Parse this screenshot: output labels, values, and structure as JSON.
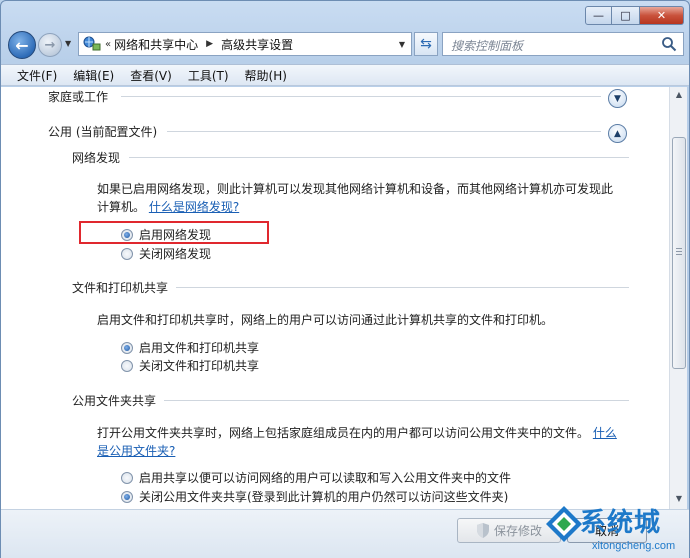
{
  "window": {
    "caption": {
      "minimize": "—",
      "maximize": "□",
      "close": "✕"
    }
  },
  "navigation": {
    "back_icon": "back-arrow",
    "forward_icon": "forward-arrow",
    "address": {
      "prefix": "«",
      "crumbs": [
        "网络和共享中心",
        "高级共享设置"
      ]
    },
    "search_placeholder": "搜索控制面板"
  },
  "menu": [
    "文件(F)",
    "编辑(E)",
    "查看(V)",
    "工具(T)",
    "帮助(H)"
  ],
  "sections": {
    "home_work": {
      "title": "家庭或工作",
      "state": "collapsed"
    },
    "public": {
      "title": "公用 (当前配置文件)",
      "state": "expanded",
      "network_discovery": {
        "title": "网络发现",
        "desc_line1": "如果已启用网络发现，则此计算机可以发现其他网络计算机和设备，而其他网络计算机亦可发现此",
        "desc_line2": "计算机。",
        "link": "什么是网络发现?",
        "options": [
          {
            "label": "启用网络发现",
            "selected": true
          },
          {
            "label": "关闭网络发现",
            "selected": false
          }
        ]
      },
      "file_printer": {
        "title": "文件和打印机共享",
        "desc": "启用文件和打印机共享时，网络上的用户可以访问通过此计算机共享的文件和打印机。",
        "options": [
          {
            "label": "启用文件和打印机共享",
            "selected": true
          },
          {
            "label": "关闭文件和打印机共享",
            "selected": false
          }
        ]
      },
      "public_folder": {
        "title": "公用文件夹共享",
        "desc_line1": "打开公用文件夹共享时，网络上包括家庭组成员在内的用户都可以访问公用文件夹中的文件。",
        "link_part1": "什么",
        "link_part2": "是公用文件夹?",
        "options": [
          {
            "label": "启用共享以便可以访问网络的用户可以读取和写入公用文件夹中的文件",
            "selected": false
          },
          {
            "label": "关闭公用文件夹共享(登录到此计算机的用户仍然可以访问这些文件夹)",
            "selected": true
          }
        ]
      }
    }
  },
  "buttons": {
    "save": "保存修改",
    "cancel": "取消"
  },
  "watermark": {
    "brand": "系统城",
    "url": "xitongcheng.com"
  },
  "colors": {
    "link": "#1a5fb4",
    "highlight": "#e0282e",
    "accent": "#2e6cb8"
  }
}
